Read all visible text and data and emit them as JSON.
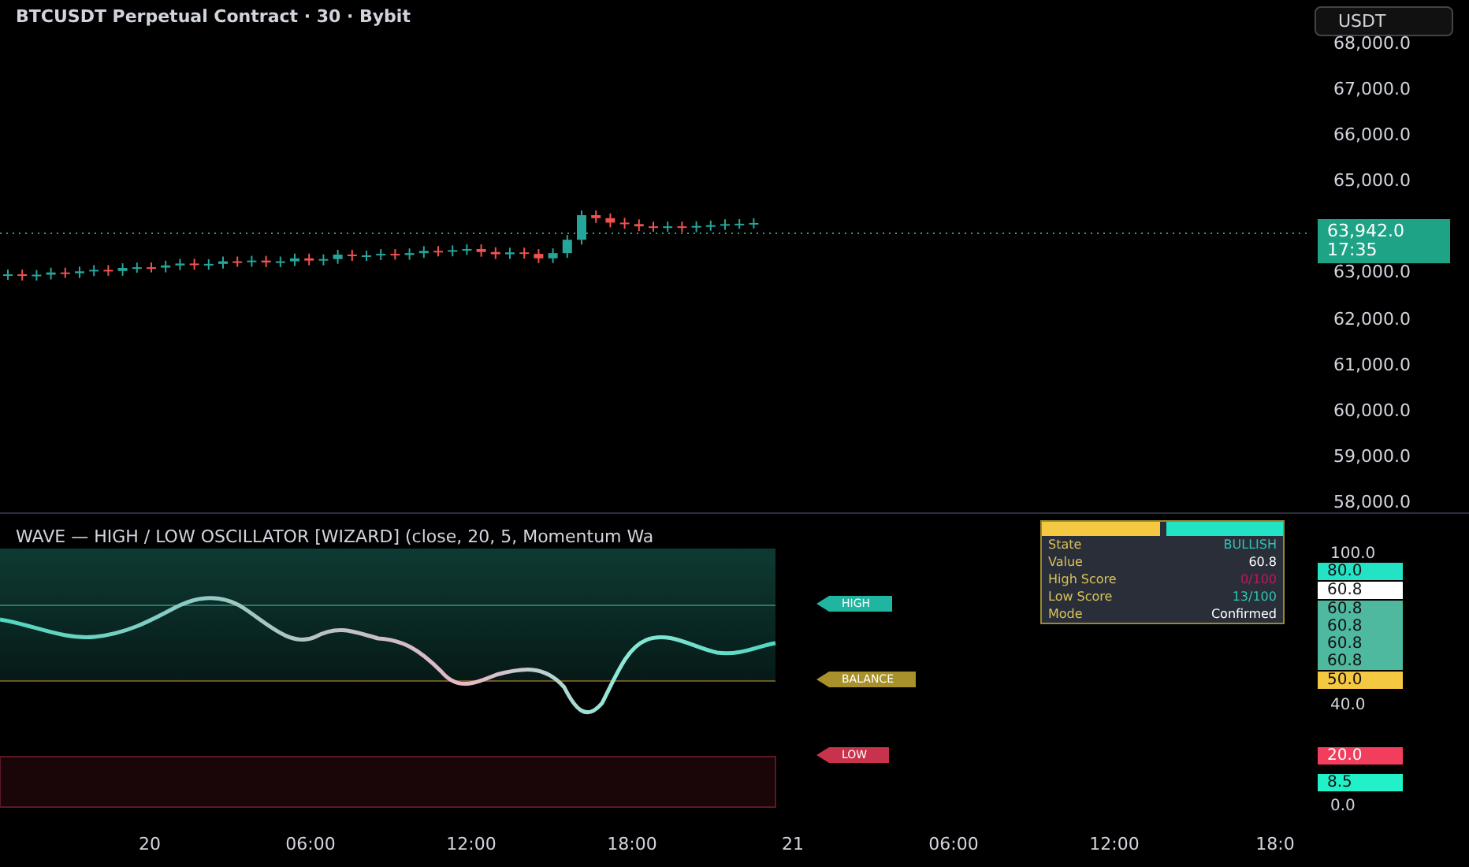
{
  "header": {
    "title": "BTCUSDT Perpetual Contract · 30 · Bybit"
  },
  "price_axis": {
    "currency_button": "USDT",
    "labels": [
      "68,000.0",
      "67,000.0",
      "66,000.0",
      "65,000.0",
      "63,000.0",
      "62,000.0",
      "61,000.0",
      "60,000.0",
      "59,000.0",
      "58,000.0"
    ],
    "last_price": "63,942.0",
    "countdown": "17:35"
  },
  "indicator": {
    "title": "WAVE — HIGH / LOW OSCILLATOR [WIZARD] (close, 20, 5, Momentum Wa",
    "table": {
      "header_cells": [
        {
          "color": "#f5c842"
        },
        {
          "color": "#22e3c4"
        }
      ],
      "rows": [
        {
          "label": "State",
          "value": "BULLISH",
          "color": "#2ec4b6"
        },
        {
          "label": "Value",
          "value": "60.8",
          "color": "#ffffff"
        },
        {
          "label": "High Score",
          "value": "0/100",
          "color": "#c2185b"
        },
        {
          "label": "Low Score",
          "value": "13/100",
          "color": "#2ec4b6"
        },
        {
          "label": "Mode",
          "value": "Confirmed",
          "color": "#ffffff"
        }
      ]
    },
    "levels": [
      {
        "label": "HIGH",
        "color": "#1fb5a0"
      },
      {
        "label": "BALANCE",
        "color": "#a8902a"
      },
      {
        "label": "LOW",
        "color": "#c8324a"
      }
    ],
    "axis": [
      {
        "text": "100.0",
        "kind": "plain"
      },
      {
        "text": "80.0",
        "kind": "badge",
        "color": "#22e3c4"
      },
      {
        "text": "60.8",
        "kind": "badge",
        "color": "#ffffff"
      },
      {
        "text": "60.8",
        "kind": "badge",
        "color": "#4fb9a0"
      },
      {
        "text": "60.8",
        "kind": "badge",
        "color": "#4fb9a0"
      },
      {
        "text": "60.8",
        "kind": "badge",
        "color": "#4fb9a0"
      },
      {
        "text": "60.8",
        "kind": "badge",
        "color": "#4fb9a0"
      },
      {
        "text": "50.0",
        "kind": "badge",
        "color": "#f5c842"
      },
      {
        "text": "40.0",
        "kind": "plain"
      },
      {
        "text": "20.0",
        "kind": "badge",
        "color": "#f23d5c"
      },
      {
        "text": "8.5",
        "kind": "badge",
        "color": "#22f0c8"
      },
      {
        "text": "0.0",
        "kind": "plain"
      }
    ]
  },
  "time_axis": [
    "20",
    "06:00",
    "12:00",
    "18:00",
    "21",
    "06:00",
    "12:00",
    "18:0"
  ]
}
